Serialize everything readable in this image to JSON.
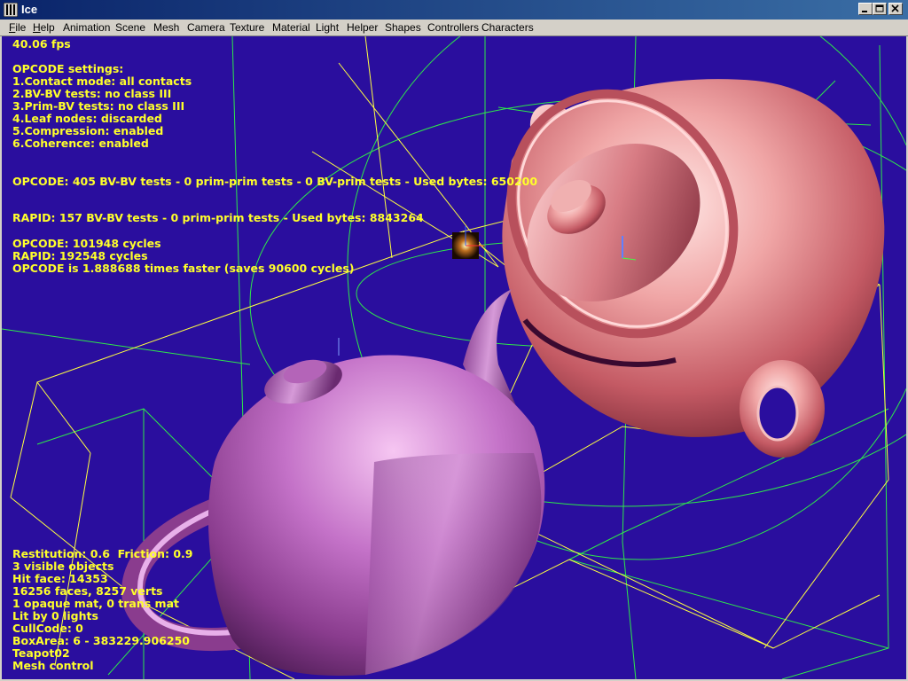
{
  "window": {
    "title": "Ice"
  },
  "menu": {
    "file_acc": "F",
    "file_rest": "ile",
    "help_acc": "H",
    "help_rest": "elp",
    "items": [
      "Animation",
      "Scene",
      "Mesh",
      "Camera",
      "Texture",
      "Material",
      "Light",
      "Helper",
      "Shapes",
      "Controllers",
      "Characters"
    ]
  },
  "colors": {
    "viewport_bg": "#2a0e9e",
    "hud_text": "#ffff2a",
    "wire_green": "#2ee84a",
    "wire_yellow": "#ffff40",
    "titlebar": "#0a246a"
  },
  "hud": {
    "fps": "40.06 fps",
    "settings_title": "OPCODE settings:",
    "settings": [
      "1.Contact mode: all contacts",
      "2.BV-BV tests: no class III",
      "3.Prim-BV tests: no class III",
      "4.Leaf nodes: discarded",
      "5.Compression: enabled",
      "6.Coherence: enabled"
    ],
    "opcode_tests": "OPCODE: 405 BV-BV tests - 0 prim-prim tests - 0 BV-prim tests - Used bytes: 650200",
    "rapid_tests": "RAPID: 157 BV-BV tests - 0 prim-prim tests - Used bytes: 8843264",
    "opcode_cycles": "OPCODE: 101948 cycles",
    "rapid_cycles": "RAPID: 192548 cycles",
    "speed": "OPCODE is 1.888688 times faster (saves 90600 cycles)",
    "bottom": [
      "Restitution: 0.6  Friction: 0.9",
      "3 visible objects",
      "Hit face: 14353",
      "16256 faces, 8257 verts",
      "1 opaque mat, 0 trans mat",
      "Lit by 0 lights",
      "CullCode: 0",
      "BoxArea: 6 - 383229.906250",
      "Teapot02",
      "Mesh control"
    ]
  }
}
